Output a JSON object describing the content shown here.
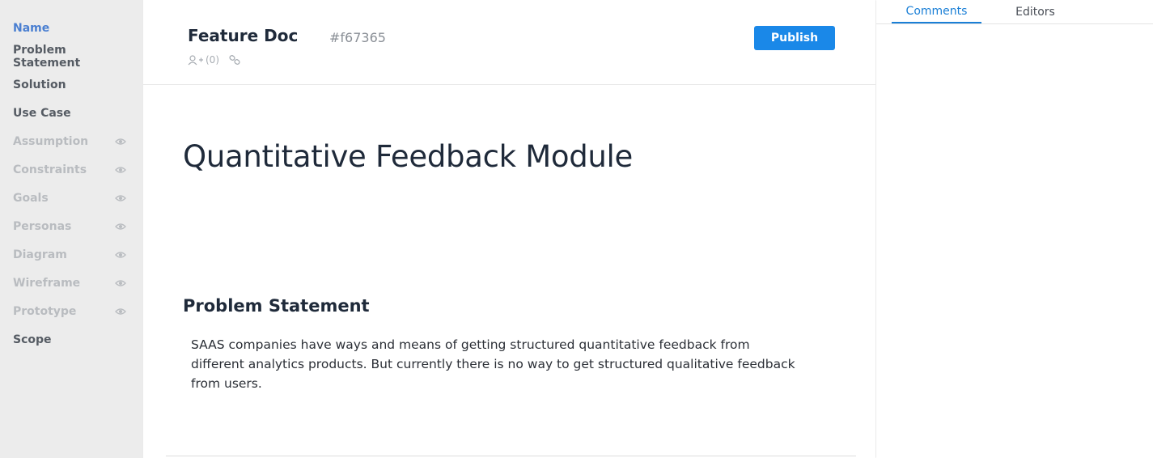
{
  "sidebar": {
    "items": [
      {
        "label": "Name",
        "state": "active"
      },
      {
        "label": "Problem Statement",
        "state": "normal"
      },
      {
        "label": "Solution",
        "state": "normal"
      },
      {
        "label": "Use Case",
        "state": "normal"
      },
      {
        "label": "Assumption",
        "state": "hidden",
        "icon": "eye-icon"
      },
      {
        "label": "Constraints",
        "state": "hidden",
        "icon": "eye-icon"
      },
      {
        "label": "Goals",
        "state": "hidden",
        "icon": "eye-icon"
      },
      {
        "label": "Personas",
        "state": "hidden",
        "icon": "eye-icon"
      },
      {
        "label": "Diagram",
        "state": "hidden",
        "icon": "eye-icon"
      },
      {
        "label": "Wireframe",
        "state": "hidden",
        "icon": "eye-icon"
      },
      {
        "label": "Prototype",
        "state": "hidden",
        "icon": "eye-icon"
      },
      {
        "label": "Scope",
        "state": "normal"
      }
    ]
  },
  "header": {
    "title": "Feature Doc",
    "doc_id": "#f67365",
    "add_user_count": "(0)",
    "add_user_icon": "add-user-icon",
    "link_icon": "link-icon",
    "publish_label": "Publish"
  },
  "document": {
    "heading": "Quantitative Feedback Module",
    "sections": [
      {
        "title": "Problem Statement",
        "body": "SAAS companies have ways and means of getting structured quantitative feedback from different analytics products. But currently there is no way to get structured qualitative feedback from users."
      }
    ]
  },
  "right_panel": {
    "tabs": [
      {
        "label": "Comments",
        "active": true
      },
      {
        "label": "Editors",
        "active": false
      }
    ]
  },
  "colors": {
    "accent": "#1a88e8",
    "active_nav": "#4a7fd1",
    "sidebar_bg": "#ececec"
  }
}
